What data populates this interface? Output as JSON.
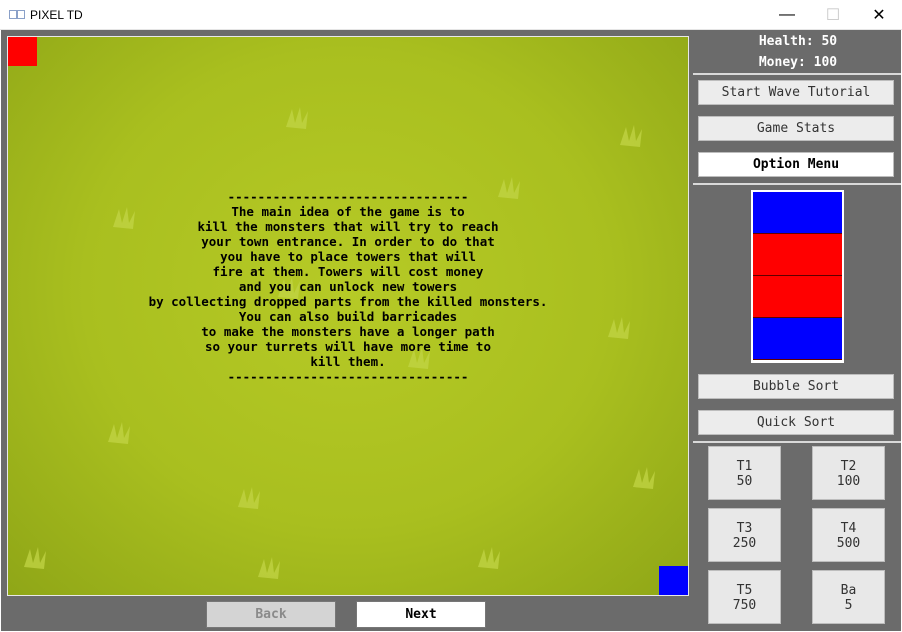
{
  "window": {
    "title": "PIXEL TD",
    "minimize_glyph": "—",
    "maximize_glyph": "☐",
    "close_glyph": "✕"
  },
  "game": {
    "tutorial_lines": [
      "--------------------------------",
      "The main idea of the game is to",
      "kill the monsters that will try to reach",
      "your town entrance. In order to do that",
      "you have to place towers that will",
      "fire at them. Towers will cost money",
      "and you can unlock new towers",
      "by collecting dropped parts from the killed monsters.",
      "You can also build barricades",
      "to make the monsters have a longer path",
      "so your turrets will have more time to",
      "kill them.",
      "--------------------------------"
    ],
    "back_label": "Back",
    "next_label": "Next",
    "start_marker_color": "#ff0000",
    "end_marker_color": "#0000ff"
  },
  "sidebar": {
    "health": "Health: 50",
    "money": "Money: 100",
    "start_wave_label": "Start Wave Tutorial",
    "game_stats_label": "Game Stats",
    "option_menu_label": "Option Menu",
    "sort_bars": [
      "#0000ff",
      "#ff0000",
      "#ff0000",
      "#0000ff"
    ],
    "bubble_sort_label": "Bubble Sort",
    "quick_sort_label": "Quick Sort",
    "towers": [
      {
        "name": "T1",
        "cost": "50"
      },
      {
        "name": "T2",
        "cost": "100"
      },
      {
        "name": "T3",
        "cost": "250"
      },
      {
        "name": "T4",
        "cost": "500"
      },
      {
        "name": "T5",
        "cost": "750"
      },
      {
        "name": "Ba",
        "cost": "5"
      }
    ]
  }
}
